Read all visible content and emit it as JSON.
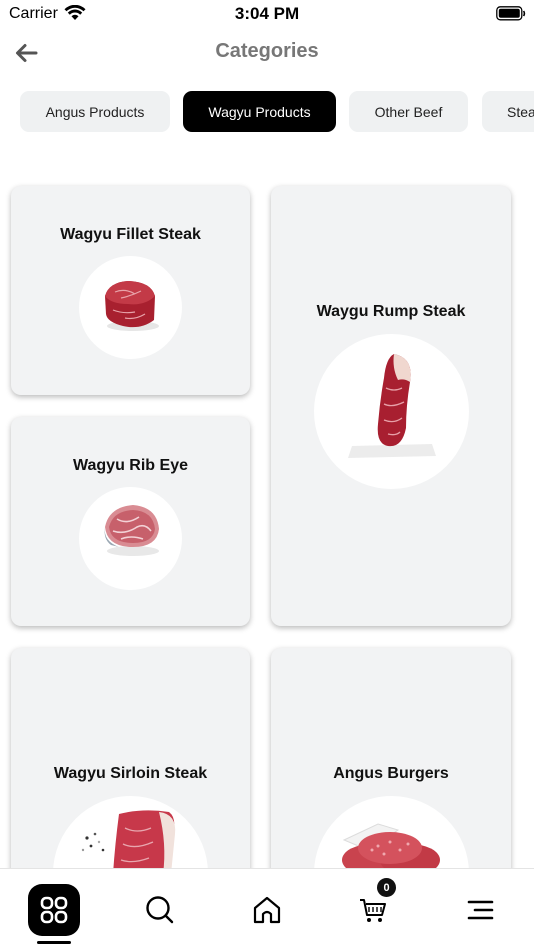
{
  "status_bar": {
    "carrier": "Carrier",
    "time": "3:04 PM"
  },
  "header": {
    "title": "Categories"
  },
  "tabs": [
    {
      "label": "Angus Products",
      "active": false
    },
    {
      "label": "Wagyu Products",
      "active": true
    },
    {
      "label": "Other Beef",
      "active": false
    },
    {
      "label": "Steak",
      "active": false
    }
  ],
  "products": [
    {
      "name": "Wagyu Fillet Steak",
      "image": "fillet-steak-image"
    },
    {
      "name": "Waygu Rump Steak",
      "image": "rump-steak-image"
    },
    {
      "name": "Wagyu Rib Eye",
      "image": "rib-eye-image"
    },
    {
      "name": "Wagyu Sirloin Steak",
      "image": "sirloin-steak-image"
    },
    {
      "name": "Angus Burgers",
      "image": "burger-patties-image"
    }
  ],
  "bottom_nav": {
    "items": [
      "categories-icon",
      "search-icon",
      "home-icon",
      "cart-icon",
      "menu-icon"
    ],
    "active": "categories-icon",
    "cart_count": "0"
  },
  "colors": {
    "accent": "#000000",
    "card_bg": "#f2f3f4",
    "tab_bg": "#eff1f2",
    "title_gray": "#777777"
  }
}
